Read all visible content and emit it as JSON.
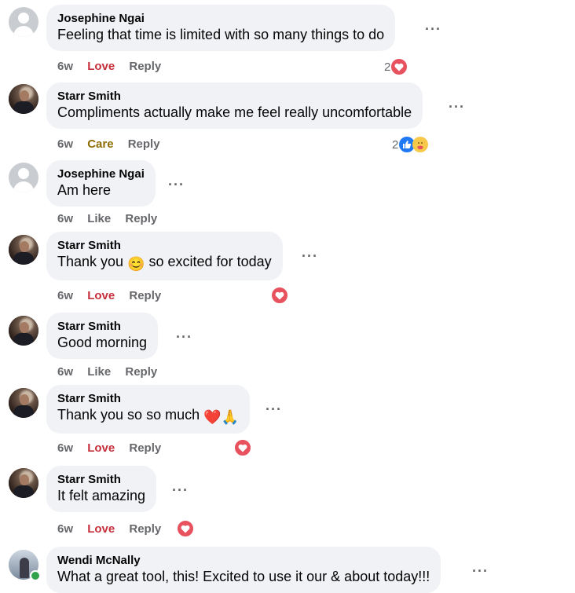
{
  "comments": [
    {
      "author": "Josephine Ngai",
      "text": "Feeling that time is limited with so many things to do",
      "time": "6w",
      "reaction_label": "Love",
      "reply_label": "Reply",
      "reaction_count": "2",
      "reaction_icons": [
        "heart-icon"
      ]
    },
    {
      "author": "Starr Smith",
      "text": "Compliments actually make me feel really uncomfortable",
      "time": "6w",
      "reaction_label": "Care",
      "reply_label": "Reply",
      "reaction_count": "2",
      "reaction_icons": [
        "like-icon",
        "care-icon"
      ]
    },
    {
      "author": "Josephine Ngai",
      "text": "Am here",
      "time": "6w",
      "reaction_label": "Like",
      "reply_label": "Reply"
    },
    {
      "author": "Starr Smith",
      "text_before": "Thank you",
      "text_emoji": "😊",
      "text_after": "so excited for today",
      "time": "6w",
      "reaction_label": "Love",
      "reply_label": "Reply",
      "reaction_icons": [
        "heart-icon"
      ]
    },
    {
      "author": "Starr Smith",
      "text": "Good morning",
      "time": "6w",
      "reaction_label": "Like",
      "reply_label": "Reply"
    },
    {
      "author": "Starr Smith",
      "text_before": "Thank you so so much",
      "text_emoji": "❤️🙏",
      "time": "6w",
      "reaction_label": "Love",
      "reply_label": "Reply",
      "reaction_icons": [
        "heart-icon"
      ]
    },
    {
      "author": "Starr Smith",
      "text": "It felt amazing",
      "time": "6w",
      "reaction_label": "Love",
      "reply_label": "Reply",
      "reaction_icons": [
        "heart-icon"
      ]
    },
    {
      "author": "Wendi McNally",
      "text": "What a great tool, this! Excited to use it our & about today!!!",
      "online": true
    }
  ],
  "more_label": "···",
  "colors": {
    "bubble": "#f0f2f5",
    "love": "#c6303c",
    "care": "#8e6d04",
    "like_blue": "#2078f4",
    "heart": "#e8525f",
    "online": "#31a24c"
  }
}
